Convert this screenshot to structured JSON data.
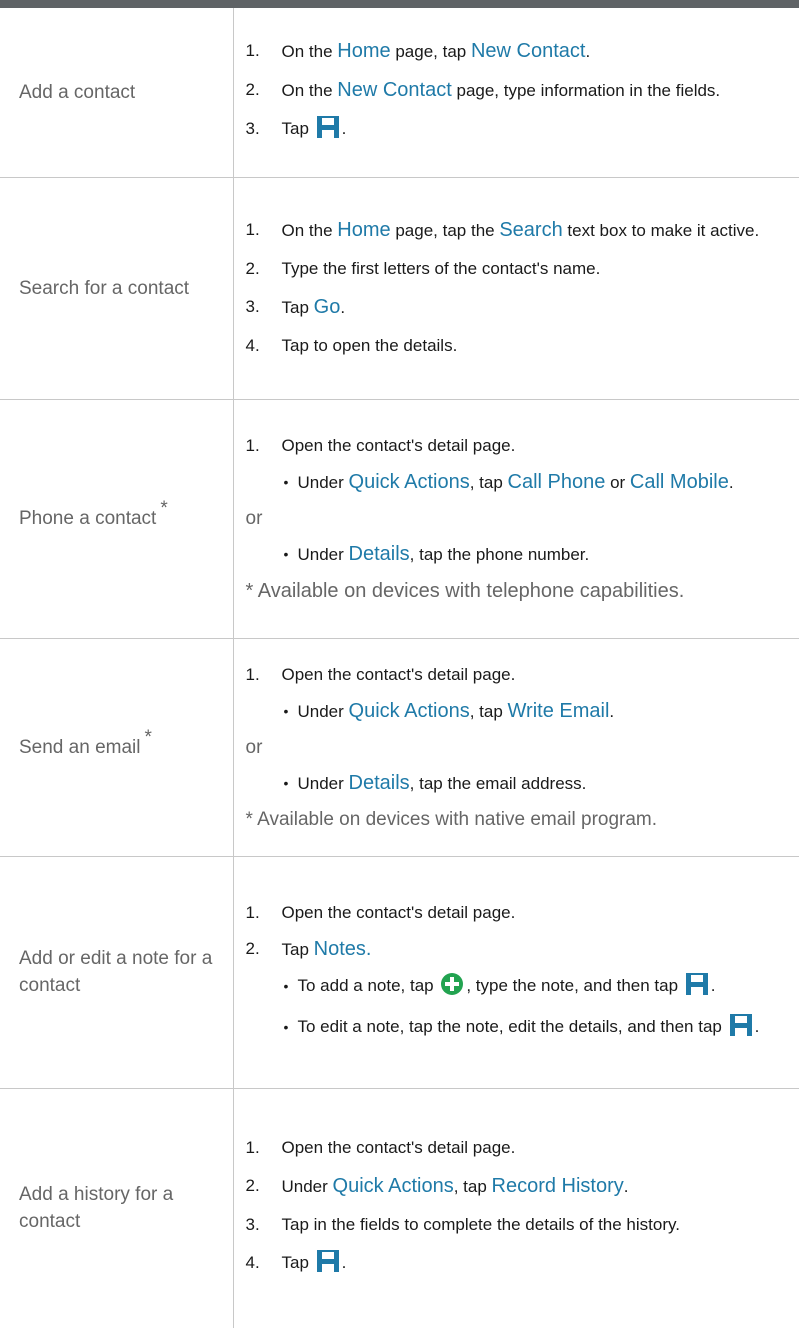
{
  "theme": {
    "link": "#1f7aa8",
    "header_bar": "#5f6366",
    "icon_green": "#22a350",
    "icon_blue": "#1f7aa8"
  },
  "icons": {
    "save": "save-icon",
    "add": "add-circle-icon"
  },
  "rows": [
    {
      "task": "Add a contact",
      "steps": [
        {
          "num": "1.",
          "t1": "On the ",
          "l1": "Home",
          "t2": " page, tap ",
          "l2": "New Contact",
          "t3": "."
        },
        {
          "num": "2.",
          "t1": "On the ",
          "l1": "New Contact",
          "t2": " page, type information in the fields."
        },
        {
          "num": "3.",
          "t1": "Tap ",
          "t2": "."
        }
      ]
    },
    {
      "task": "Search for a contact",
      "steps": [
        {
          "num": "1.",
          "t1": "On the ",
          "l1": "Home",
          "t2": " page, tap the ",
          "l2": "Search",
          "t3": " text box to make it active."
        },
        {
          "num": "2.",
          "t1": "Type the first letters of the contact's name."
        },
        {
          "num": "3.",
          "t1": "Tap ",
          "l1": "Go",
          "t2": "."
        },
        {
          "num": "4.",
          "t1": "Tap to open the details."
        }
      ]
    },
    {
      "task": "Phone a contact",
      "sup": "*",
      "step1": {
        "num": "1.",
        "text": "Open the contact's detail page."
      },
      "bullet1": {
        "dot": "•",
        "t1": "Under ",
        "l1": "Quick Actions",
        "t2": ", tap ",
        "l2": "Call Phone",
        "t3": " or ",
        "l3": "Call Mobile",
        "t4": "."
      },
      "or": "or",
      "bullet2": {
        "dot": "•",
        "t1": "Under ",
        "l1": "Details",
        "t2": ", tap the phone number."
      },
      "note": "* Available on devices with telephone capabilities."
    },
    {
      "task": "Send an email",
      "sup": "*",
      "step1": {
        "num": "1.",
        "text": "Open the contact's detail page."
      },
      "bullet1": {
        "dot": "•",
        "t1": "Under ",
        "l1": "Quick Actions",
        "t2": ", tap ",
        "l2": "Write Email",
        "t3": "."
      },
      "or": "or",
      "bullet2": {
        "dot": "•",
        "t1": "Under ",
        "l1": "Details",
        "t2": ", tap the email address."
      },
      "note": "* Available on devices with native email program."
    },
    {
      "task": "Add or edit a note for a contact",
      "step1": {
        "num": "1.",
        "text": "Open the contact's detail page."
      },
      "step2": {
        "num": "2.",
        "t1": "Tap ",
        "l1": "Notes."
      },
      "bullet1": {
        "dot": "•",
        "t1": "To add a note, tap ",
        "t2": ", type the note, and then tap ",
        "t3": "."
      },
      "bullet2": {
        "dot": "•",
        "t1": "To edit a note, tap the note, edit the details, and then tap ",
        "t2": "."
      }
    },
    {
      "task": "Add a history for a contact",
      "steps": [
        {
          "num": "1.",
          "t1": "Open the contact's detail page."
        },
        {
          "num": "2.",
          "t1": "Under ",
          "l1": "Quick Actions",
          "t2": ", tap ",
          "l2": "Record History",
          "t3": "."
        },
        {
          "num": "3.",
          "t1": "Tap in the fields to complete the details of the history."
        },
        {
          "num": "4.",
          "t1": "Tap ",
          "t2": "."
        }
      ]
    }
  ]
}
